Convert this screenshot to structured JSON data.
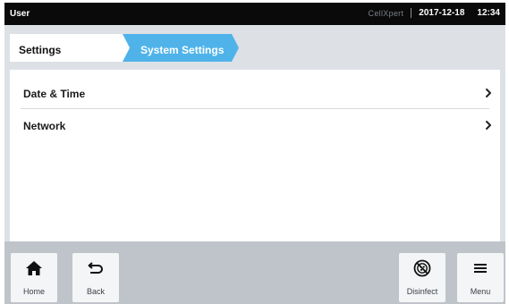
{
  "status_bar": {
    "user": "User",
    "device": "CellXpert",
    "date": "2017-12-18",
    "time": "12:34"
  },
  "breadcrumb": {
    "items": [
      "Settings",
      "System Settings"
    ],
    "active_color": "#4fb3ea"
  },
  "menu": {
    "items": [
      {
        "label": "Date & Time",
        "icon": "chevron-right-icon"
      },
      {
        "label": "Network",
        "icon": "chevron-right-icon"
      }
    ]
  },
  "bottom_bar": {
    "home": {
      "label": "Home",
      "icon": "home-icon"
    },
    "back": {
      "label": "Back",
      "icon": "back-arrow-icon"
    },
    "disinfect": {
      "label": "Disinfect",
      "icon": "disinfect-icon"
    },
    "menu": {
      "label": "Menu",
      "icon": "hamburger-menu-icon"
    }
  }
}
